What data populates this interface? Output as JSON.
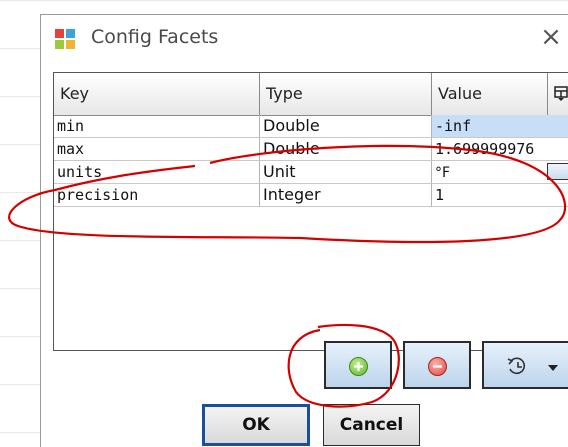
{
  "window": {
    "title": "Config Facets",
    "close_glyph": "×"
  },
  "table": {
    "columns": [
      "Key",
      "Type",
      "Value"
    ],
    "rows": [
      {
        "key": "min",
        "type": "Double",
        "value": "-inf"
      },
      {
        "key": "max",
        "type": "Double",
        "value": "1.699999976"
      },
      {
        "key": "units",
        "type": "Unit",
        "value": "°F"
      },
      {
        "key": "precision",
        "type": "Integer",
        "value": "1"
      }
    ]
  },
  "toolbar": {
    "add_icon": "plus-circle-icon",
    "remove_icon": "minus-circle-icon",
    "history_icon": "history-icon"
  },
  "buttons": {
    "ok": "OK",
    "cancel": "Cancel"
  },
  "colors": {
    "selection": "#c6def6",
    "annotation": "#d40000",
    "accent": "#1a4f9e"
  }
}
